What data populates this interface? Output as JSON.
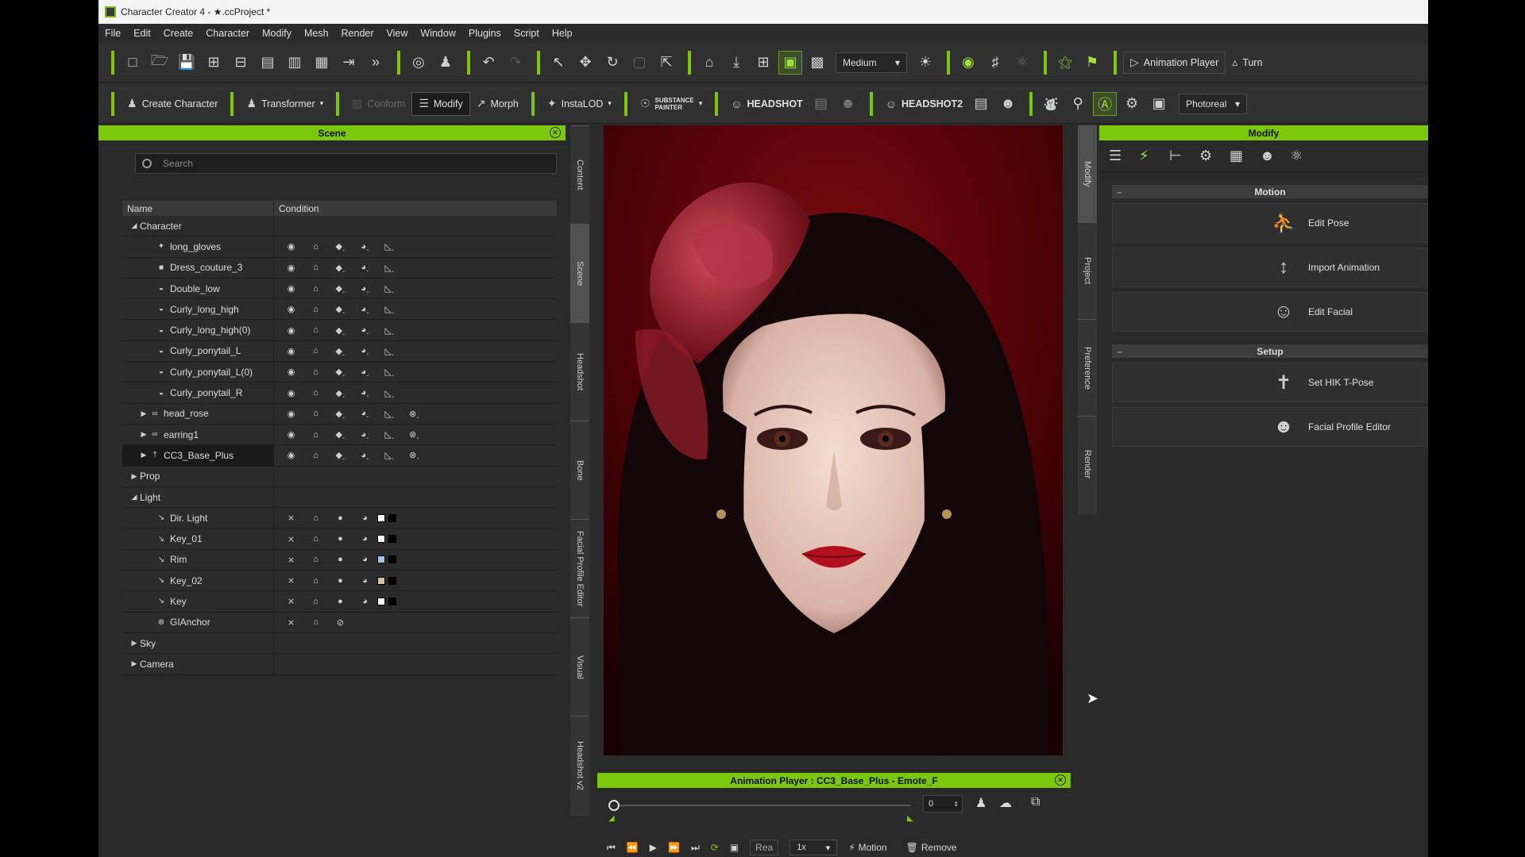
{
  "window": {
    "title": "Character Creator 4 - ★.ccProject *"
  },
  "menu": [
    "File",
    "Edit",
    "Create",
    "Character",
    "Modify",
    "Mesh",
    "Render",
    "View",
    "Window",
    "Plugins",
    "Script",
    "Help"
  ],
  "toolbar1": {
    "quality": "Medium",
    "animation_player": "Animation Player",
    "turn": "Turn"
  },
  "toolbar2": {
    "create_character": "Create Character",
    "transformer": "Transformer",
    "conform": "Conform",
    "modify": "Modify",
    "morph": "Morph",
    "instalod": "InstaLOD",
    "substance_1": "SUBSTANCE",
    "substance_2": "PAINTER",
    "headshot": "HEADSHOT",
    "headshot2": "HEADSHOT2",
    "render_mode": "Photoreal"
  },
  "scene": {
    "title": "Scene",
    "search_placeholder": "Search",
    "columns": {
      "name": "Name",
      "condition": "Condition"
    },
    "rows": [
      {
        "label": "Character",
        "arrow": "◢",
        "indent": 8,
        "icon": "",
        "type": "group"
      },
      {
        "label": "long_gloves",
        "arrow": "",
        "indent": 42,
        "icon": "✦",
        "type": "obj"
      },
      {
        "label": "Dress_couture_3",
        "arrow": "",
        "indent": 42,
        "icon": "■",
        "type": "obj"
      },
      {
        "label": "Double_low",
        "arrow": "",
        "indent": 42,
        "icon": "◒",
        "type": "obj"
      },
      {
        "label": "Curly_long_high",
        "arrow": "",
        "indent": 42,
        "icon": "◒",
        "type": "obj"
      },
      {
        "label": "Curly_long_high(0)",
        "arrow": "",
        "indent": 42,
        "icon": "◒",
        "type": "obj"
      },
      {
        "label": "Curly_ponytail_L",
        "arrow": "",
        "indent": 42,
        "icon": "◒",
        "type": "obj"
      },
      {
        "label": "Curly_ponytail_L(0)",
        "arrow": "",
        "indent": 42,
        "icon": "◒",
        "type": "obj"
      },
      {
        "label": "Curly_ponytail_R",
        "arrow": "",
        "indent": 42,
        "icon": "◒",
        "type": "obj"
      },
      {
        "label": "head_rose",
        "arrow": "▶",
        "indent": 20,
        "icon": "∞",
        "type": "acc"
      },
      {
        "label": "earring1",
        "arrow": "▶",
        "indent": 20,
        "icon": "∞",
        "type": "acc"
      },
      {
        "label": "CC3_Base_Plus",
        "arrow": "▶",
        "indent": 20,
        "icon": "†",
        "type": "acc",
        "selected": true
      },
      {
        "label": "Prop",
        "arrow": "▶",
        "indent": 8,
        "icon": "",
        "type": "group"
      },
      {
        "label": "Light",
        "arrow": "◢",
        "indent": 8,
        "icon": "",
        "type": "group"
      },
      {
        "label": "Dir. Light",
        "arrow": "",
        "indent": 42,
        "icon": "↘",
        "type": "light",
        "color": "#ffffff"
      },
      {
        "label": "Key_01",
        "arrow": "",
        "indent": 42,
        "icon": "↘",
        "type": "light",
        "color": "#ffffff"
      },
      {
        "label": "Rim",
        "arrow": "",
        "indent": 42,
        "icon": "↘",
        "type": "light",
        "color": "#a7c3ea"
      },
      {
        "label": "Key_02",
        "arrow": "",
        "indent": 42,
        "icon": "↘",
        "type": "light",
        "color": "#d9bfa6"
      },
      {
        "label": "Key",
        "arrow": "",
        "indent": 42,
        "icon": "↘",
        "type": "light",
        "color": "#ffffff"
      },
      {
        "label": "GIAnchor",
        "arrow": "",
        "indent": 42,
        "icon": "⊕",
        "type": "anchor"
      },
      {
        "label": "Sky",
        "arrow": "▶",
        "indent": 8,
        "icon": "",
        "type": "group"
      },
      {
        "label": "Camera",
        "arrow": "▶",
        "indent": 8,
        "icon": "",
        "type": "group"
      }
    ]
  },
  "left_tabs": [
    "Content",
    "Scene",
    "Headshot",
    "Bone",
    "Facial Profile Editor",
    "Visual",
    "Headshot v2"
  ],
  "right_tabs": [
    "Modify",
    "Project",
    "Preference",
    "Render"
  ],
  "animation_player": {
    "title": "Animation Player : CC3_Base_Plus - Emote_F",
    "frame": "0",
    "real": "Rea",
    "speed": "1x",
    "motion": "Motion",
    "remove": "Remove"
  },
  "modify": {
    "title": "Modify",
    "sections": [
      {
        "title": "Motion",
        "items": [
          {
            "label": "Edit Pose",
            "icon": "pose-icon"
          },
          {
            "label": "Import Animation",
            "icon": "import-animation-icon"
          },
          {
            "label": "Edit Facial",
            "icon": "edit-facial-icon"
          }
        ]
      },
      {
        "title": "Setup",
        "items": [
          {
            "label": "Set HIK T-Pose",
            "icon": "tpose-icon"
          },
          {
            "label": "Facial Profile Editor",
            "icon": "facial-profile-icon"
          }
        ]
      }
    ]
  },
  "colors": {
    "accent": "#7ac70c",
    "panel": "#2a2a2a"
  }
}
